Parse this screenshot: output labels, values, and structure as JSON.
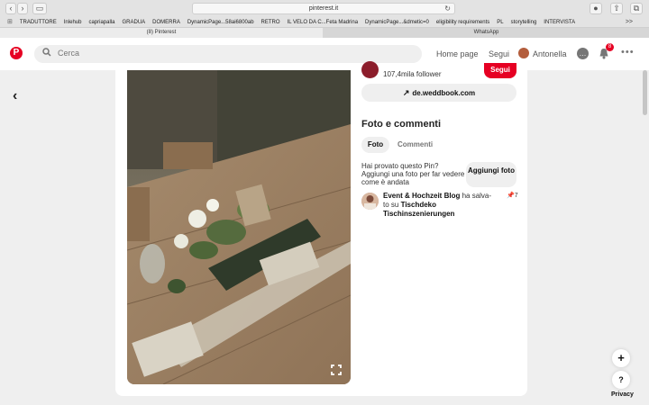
{
  "browser": {
    "url": "pinterest.it",
    "bookmarks": [
      "TRADUTTORE",
      "Inlehub",
      "capriapalla",
      "GRADUA",
      "DOMERRA",
      "DynamicPage...58ai6800ab",
      "RETRO",
      "IL VELO DA C...Feta Madrina",
      "DynamicPage...&dmetic=0",
      "eligibility requirements",
      "PL",
      "storytelling",
      "INTERVISTA"
    ],
    "bookmarks_more": ">>",
    "tabs": [
      {
        "label": "(8) Pinterest",
        "active": true
      },
      {
        "label": "WhatsApp",
        "active": false
      }
    ]
  },
  "header": {
    "logo": "P",
    "search_placeholder": "Cerca",
    "home": "Home page",
    "following": "Segui",
    "user": "Antonella",
    "notification_count": "8"
  },
  "pin": {
    "followers": "107,4mila follower",
    "follow_button": "Segui",
    "link": "de.weddbook.com",
    "section_title": "Foto e commenti",
    "tab_photo": "Foto",
    "tab_comments": "Commenti",
    "prompt": "Hai provato questo Pin? Aggiungi una foto per far vedere come è andata",
    "add_photo": "Aggiungi foto",
    "activity": {
      "author": "Event & Hochzeit Blog",
      "verb": "ha salva-",
      "preposition": "to su",
      "board": "Tischdeko Tischinszenierungen",
      "count": "7"
    }
  },
  "floating": {
    "plus": "+",
    "help": "?",
    "privacy": "Privacy"
  },
  "colors": {
    "brand": "#e60023",
    "header_bg": "#ffffff",
    "page_bg": "#efefef"
  }
}
